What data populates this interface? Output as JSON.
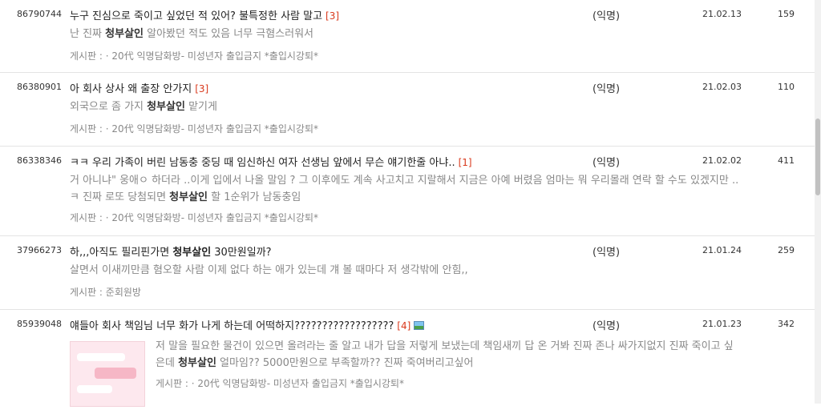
{
  "posts": [
    {
      "id": "86790744",
      "title": "누구 진심으로 죽이고 싶었던 적 있어? 불특정한 사람 말고",
      "comments": "[3]",
      "snippet_before": "난 진짜 ",
      "keyword": "청부살인",
      "snippet_after": " 알아봤던 적도 있음 너무 극혐스러워서",
      "board": "게시판 : · 20代 익명담화방- 미성년자 출입금지 *출입시강퇴*",
      "author": "(익명)",
      "date": "21.02.13",
      "views": "159"
    },
    {
      "id": "86380901",
      "title": "아 회사 상사 왜 출장 안가지",
      "comments": "[3]",
      "snippet_before": "외국으로 좀 가지 ",
      "keyword": "청부살인",
      "snippet_after": " 맡기게",
      "board": "게시판 : · 20代 익명담화방- 미성년자 출입금지 *출입시강퇴*",
      "author": "(익명)",
      "date": "21.02.03",
      "views": "110"
    },
    {
      "id": "86338346",
      "title": "ㅋㅋ 우리 가족이 버린 남동충 중딩 때 임신하신 여자 선생님 앞에서 무슨 얘기한줄 아냐..",
      "comments": "[1]",
      "snippet_before": "거 아니냐\" 웅애ㅇ 하더라 ..이게 입에서 나올 말임 ? 그 이후에도 계속 사고치고 지랄해서 지금은 아예 버렸음 엄마는 뭐 우리몰래 연락 할 수도 있겠지만 .. ㅋ 진짜 로또 당첨되면 ",
      "keyword": "청부살인",
      "snippet_after": " 할 1순위가 남동충임",
      "board": "게시판 : · 20代 익명담화방- 미성년자 출입금지 *출입시강퇴*",
      "author": "(익명)",
      "date": "21.02.02",
      "views": "411"
    },
    {
      "id": "37966273",
      "title_before": "하,,,아직도 필리핀가면 ",
      "title_keyword": "청부살인",
      "title_after": " 30만원일까?",
      "snippet_text": "살면서 이새끼만큼 혐오할 사람 이제 없다 하는 애가 있는데 걔 볼 때마다 저 생각밖에 안힘,,",
      "board": "게시판 : 준회원방",
      "author": "(익명)",
      "date": "21.01.24",
      "views": "259"
    },
    {
      "id": "85939048",
      "title": "얘들아 회사 책임님 너무 화가 나게 하는데 어떡하지??????????????????",
      "comments": "[4]",
      "image_icon": "image-attached-icon",
      "snippet_before": "저 말을 필요한 물건이 있으면 올려라는 줄 알고 내가 답을 저렇게 보냈는데 책임새끼 답 온 거봐 진짜 존나 싸가지없지 진짜 죽이고 싶은데 ",
      "keyword": "청부살인",
      "snippet_after": " 얼마임?? 5000만원으로 부족할까?? 진짜 죽여버리고싶어",
      "board": "게시판 : · 20代 익명담화방- 미성년자 출입금지 *출입시강퇴*",
      "author": "(익명)",
      "date": "21.01.23",
      "views": "342"
    }
  ],
  "colors": {
    "keyword": "#333333",
    "comment_count": "#d9391c",
    "snippet": "#888888"
  }
}
